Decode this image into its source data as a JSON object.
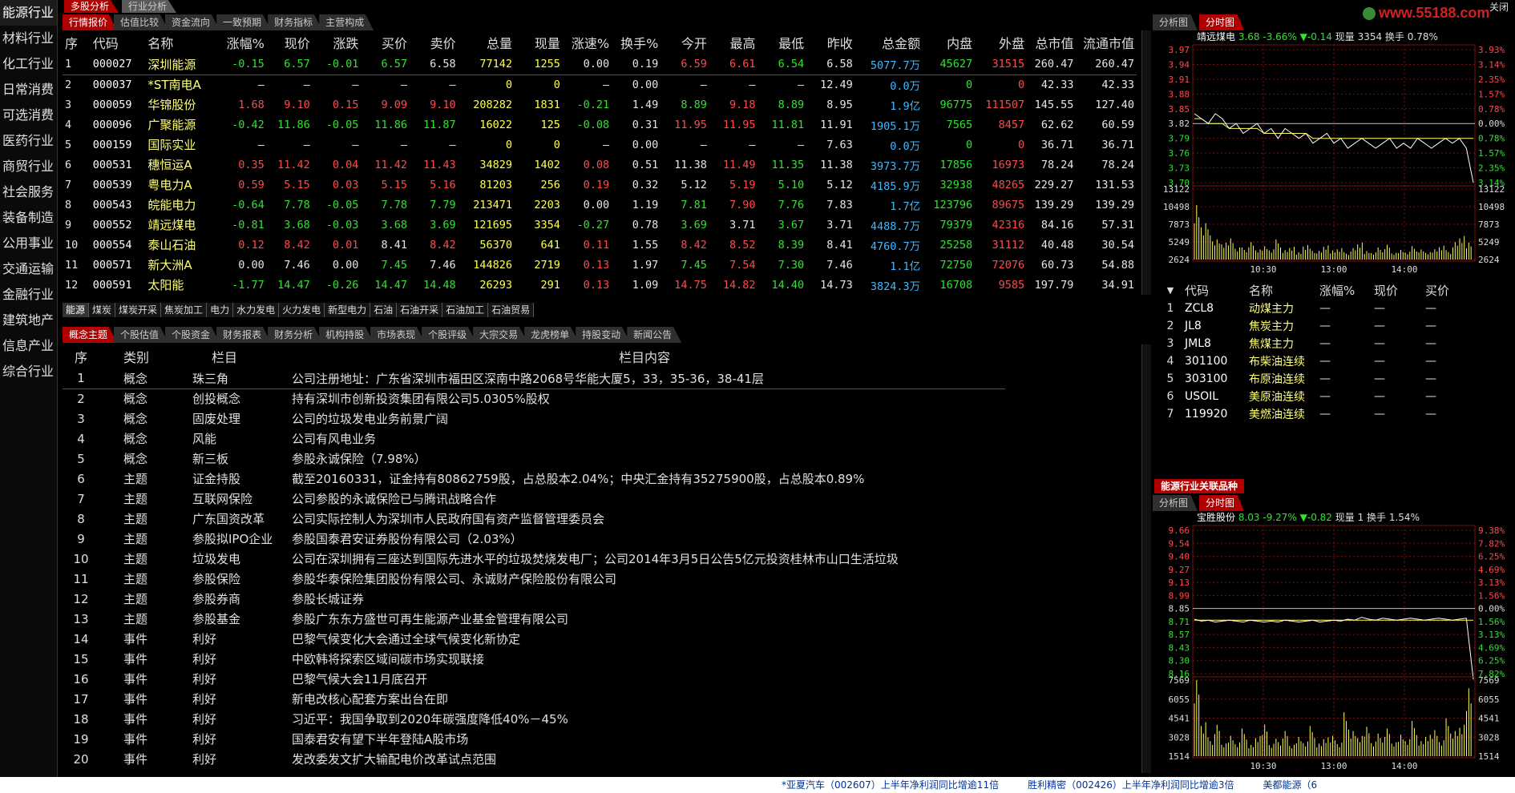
{
  "sidebar": {
    "items": [
      "能源行业",
      "材料行业",
      "化工行业",
      "日常消费",
      "可选消费",
      "医药行业",
      "商贸行业",
      "社会服务",
      "装备制造",
      "公用事业",
      "交通运输",
      "金融行业",
      "建筑地产",
      "信息产业",
      "综合行业"
    ]
  },
  "top_tabs": [
    "多股分析",
    "行业分析"
  ],
  "close_label": "关闭",
  "logo_text": "www.55188.com",
  "quote_tabs": [
    "行情报价",
    "估值比较",
    "资金流向",
    "一致预期",
    "财务指标",
    "主营构成"
  ],
  "quote_table": {
    "headers": [
      "序",
      "代码",
      "名称",
      "涨幅%",
      "现价",
      "涨跌",
      "买价",
      "卖价",
      "总量",
      "现量",
      "涨速%",
      "换手%",
      "今开",
      "最高",
      "最低",
      "昨收",
      "总金额",
      "内盘",
      "外盘",
      "总市值",
      "流通市值"
    ],
    "rows": [
      [
        "1",
        "000027",
        "深圳能源",
        "-0.15",
        "6.57",
        "-0.01",
        "6.57",
        "6.58",
        "77142",
        "1255",
        "0.00",
        "0.19",
        "6.59",
        "6.61",
        "6.54",
        "6.58",
        "5077.7万",
        "45627",
        "31515",
        "260.47",
        "260.47"
      ],
      [
        "2",
        "000037",
        "*ST南电A",
        "—",
        "—",
        "—",
        "—",
        "—",
        "0",
        "0",
        "—",
        "0.00",
        "—",
        "—",
        "—",
        "12.49",
        "0.0万",
        "0",
        "0",
        "42.33",
        "42.33"
      ],
      [
        "3",
        "000059",
        "华锦股份",
        "1.68",
        "9.10",
        "0.15",
        "9.09",
        "9.10",
        "208282",
        "1831",
        "-0.21",
        "1.49",
        "8.89",
        "9.18",
        "8.89",
        "8.95",
        "1.9亿",
        "96775",
        "111507",
        "145.55",
        "127.40"
      ],
      [
        "4",
        "000096",
        "广聚能源",
        "-0.42",
        "11.86",
        "-0.05",
        "11.86",
        "11.87",
        "16022",
        "125",
        "-0.08",
        "0.31",
        "11.95",
        "11.95",
        "11.81",
        "11.91",
        "1905.1万",
        "7565",
        "8457",
        "62.62",
        "60.59"
      ],
      [
        "5",
        "000159",
        "国际实业",
        "—",
        "—",
        "—",
        "—",
        "—",
        "0",
        "0",
        "—",
        "0.00",
        "—",
        "—",
        "—",
        "7.63",
        "0.0万",
        "0",
        "0",
        "36.71",
        "36.71"
      ],
      [
        "6",
        "000531",
        "穗恒运A",
        "0.35",
        "11.42",
        "0.04",
        "11.42",
        "11.43",
        "34829",
        "1402",
        "0.08",
        "0.51",
        "11.38",
        "11.49",
        "11.35",
        "11.38",
        "3973.7万",
        "17856",
        "16973",
        "78.24",
        "78.24"
      ],
      [
        "7",
        "000539",
        "粤电力A",
        "0.59",
        "5.15",
        "0.03",
        "5.15",
        "5.16",
        "81203",
        "256",
        "0.19",
        "0.32",
        "5.12",
        "5.19",
        "5.10",
        "5.12",
        "4185.9万",
        "32938",
        "48265",
        "229.27",
        "131.53"
      ],
      [
        "8",
        "000543",
        "皖能电力",
        "-0.64",
        "7.78",
        "-0.05",
        "7.78",
        "7.79",
        "213471",
        "2203",
        "0.00",
        "1.19",
        "7.81",
        "7.90",
        "7.76",
        "7.83",
        "1.7亿",
        "123796",
        "89675",
        "139.29",
        "139.29"
      ],
      [
        "9",
        "000552",
        "靖远煤电",
        "-0.81",
        "3.68",
        "-0.03",
        "3.68",
        "3.69",
        "121695",
        "3354",
        "-0.27",
        "0.78",
        "3.69",
        "3.71",
        "3.67",
        "3.71",
        "4488.7万",
        "79379",
        "42316",
        "84.16",
        "57.31"
      ],
      [
        "10",
        "000554",
        "泰山石油",
        "0.12",
        "8.42",
        "0.01",
        "8.41",
        "8.42",
        "56370",
        "641",
        "0.11",
        "1.55",
        "8.42",
        "8.52",
        "8.39",
        "8.41",
        "4760.7万",
        "25258",
        "31112",
        "40.48",
        "30.54"
      ],
      [
        "11",
        "000571",
        "新大洲A",
        "0.00",
        "7.46",
        "0.00",
        "7.45",
        "7.46",
        "144826",
        "2719",
        "0.13",
        "1.97",
        "7.45",
        "7.54",
        "7.30",
        "7.46",
        "1.1亿",
        "72750",
        "72076",
        "60.73",
        "54.88"
      ],
      [
        "12",
        "000591",
        "太阳能",
        "-1.77",
        "14.47",
        "-0.26",
        "14.47",
        "14.48",
        "26293",
        "291",
        "0.13",
        "1.09",
        "14.75",
        "14.82",
        "14.40",
        "14.73",
        "3824.3万",
        "16708",
        "9585",
        "197.79",
        "34.91"
      ]
    ]
  },
  "industry_strip": [
    "能源",
    "煤炭",
    "煤炭开采",
    "焦炭加工",
    "电力",
    "水力发电",
    "火力发电",
    "新型电力",
    "石油",
    "石油开采",
    "石油加工",
    "石油贸易"
  ],
  "info_tabs": [
    "概念主题",
    "个股估值",
    "个股资金",
    "财务报表",
    "财务分析",
    "机构持股",
    "市场表现",
    "个股评级",
    "大宗交易",
    "龙虎榜单",
    "持股变动",
    "新闻公告"
  ],
  "concept_table": {
    "headers": [
      "序",
      "类别",
      "栏目",
      "栏目内容"
    ],
    "rows": [
      [
        "1",
        "概念",
        "珠三角",
        "公司注册地址：广东省深圳市福田区深南中路2068号华能大厦5，33，35-36，38-41层"
      ],
      [
        "2",
        "概念",
        "创投概念",
        "持有深圳市创新投资集团有限公司5.0305%股权"
      ],
      [
        "3",
        "概念",
        "固废处理",
        "公司的垃圾发电业务前景广阔"
      ],
      [
        "4",
        "概念",
        "风能",
        "公司有风电业务"
      ],
      [
        "5",
        "概念",
        "新三板",
        "参股永诚保险（7.98%）"
      ],
      [
        "6",
        "主题",
        "证金持股",
        "截至20160331，证金持有80862759股，占总股本2.04%；中央汇金持有35275900股，占总股本0.89%"
      ],
      [
        "7",
        "主题",
        "互联网保险",
        "公司参股的永诚保险已与腾讯战略合作"
      ],
      [
        "8",
        "主题",
        "广东国资改革",
        "公司实际控制人为深圳市人民政府国有资产监督管理委员会"
      ],
      [
        "9",
        "主题",
        "参股拟IPO企业",
        "参股国泰君安证券股份有限公司（2.03%）"
      ],
      [
        "10",
        "主题",
        "垃圾发电",
        "公司在深圳拥有三座达到国际先进水平的垃圾焚烧发电厂；公司2014年3月5日公告5亿元投资桂林市山口生活垃圾"
      ],
      [
        "11",
        "主题",
        "参股保险",
        "参股华泰保险集团股份有限公司、永诚财产保险股份有限公司"
      ],
      [
        "12",
        "主题",
        "参股券商",
        "参股长城证券"
      ],
      [
        "13",
        "主题",
        "参股基金",
        "参股广东东方盛世可再生能源产业基金管理有限公司"
      ],
      [
        "14",
        "事件",
        "利好",
        "巴黎气候变化大会通过全球气候变化新协定"
      ],
      [
        "15",
        "事件",
        "利好",
        "中欧韩将探索区域间碳市场实现联接"
      ],
      [
        "16",
        "事件",
        "利好",
        "巴黎气候大会11月底召开"
      ],
      [
        "17",
        "事件",
        "利好",
        "新电改核心配套方案出台在即"
      ],
      [
        "18",
        "事件",
        "利好",
        "习近平：我国争取到2020年碳强度降低40%－45%"
      ],
      [
        "19",
        "事件",
        "利好",
        "国泰君安有望下半年登陆A股市场"
      ],
      [
        "20",
        "事件",
        "利好",
        "发改委发文扩大输配电价改革试点范围"
      ]
    ]
  },
  "chart1": {
    "tabs": [
      "分析图",
      "分时图"
    ],
    "header": {
      "name": "靖远煤电",
      "price": "3.68",
      "pct": "-3.66%",
      "chg": "▼-0.14",
      "vol_label": "现量",
      "vol": "3354",
      "turn_label": "换手",
      "turn": "0.78%"
    },
    "price_left": [
      "3.97",
      "3.94",
      "3.91",
      "3.88",
      "3.85",
      "3.82",
      "3.79",
      "3.76",
      "3.73",
      "3.70"
    ],
    "price_right": [
      "3.93%",
      "3.14%",
      "2.35%",
      "1.57%",
      "0.78%",
      "0.00%",
      "0.78%",
      "1.57%",
      "2.35%",
      "3.14%"
    ],
    "vol_left": [
      "13122",
      "10498",
      "7873",
      "5249",
      "2624"
    ],
    "vol_right": [
      "13122",
      "10498",
      "7873",
      "5249",
      "2624"
    ],
    "times": [
      "10:30",
      "13:00",
      "14:00"
    ],
    "price_series": [
      3.84,
      3.83,
      3.82,
      3.84,
      3.83,
      3.81,
      3.82,
      3.8,
      3.81,
      3.82,
      3.8,
      3.81,
      3.79,
      3.81,
      3.8,
      3.79,
      3.8,
      3.78,
      3.79,
      3.8,
      3.78,
      3.79,
      3.77,
      3.78,
      3.79,
      3.78,
      3.77,
      3.78,
      3.79,
      3.77,
      3.78,
      3.77,
      3.79,
      3.78,
      3.77,
      3.78,
      3.79,
      3.78,
      3.79,
      3.77,
      3.7
    ],
    "avg_series": [
      3.83,
      3.83,
      3.82,
      3.82,
      3.82,
      3.81,
      3.81,
      3.81,
      3.81,
      3.81,
      3.8,
      3.8,
      3.8,
      3.8,
      3.8,
      3.8,
      3.8,
      3.79,
      3.79,
      3.79,
      3.79,
      3.79,
      3.79,
      3.79,
      3.79,
      3.79,
      3.79,
      3.79,
      3.79,
      3.79,
      3.79,
      3.79,
      3.79,
      3.79,
      3.79,
      3.79,
      3.79,
      3.79,
      3.79,
      3.79,
      3.79
    ],
    "volumes": [
      9000,
      6000,
      4500,
      3000,
      2500,
      3500,
      2000,
      1800,
      2600,
      1500,
      2200,
      1700,
      3000,
      1400,
      1900,
      1200,
      2400,
      1600,
      1300,
      2100,
      1500,
      1900,
      1100,
      1700,
      2500,
      1400,
      1200,
      1800,
      2200,
      1000,
      1600,
      1300,
      2000,
      1500,
      1100,
      1700,
      2300,
      1400,
      2600,
      3500,
      2800
    ]
  },
  "futures_table": {
    "headers": [
      "代码",
      "名称",
      "涨幅%",
      "现价",
      "买价"
    ],
    "rows": [
      [
        "1",
        "ZCL8",
        "动煤主力",
        "—",
        "—",
        "—"
      ],
      [
        "2",
        "JL8",
        "焦炭主力",
        "—",
        "—",
        "—"
      ],
      [
        "3",
        "JML8",
        "焦煤主力",
        "—",
        "—",
        "—"
      ],
      [
        "4",
        "301100",
        "布柴油连续",
        "—",
        "—",
        "—"
      ],
      [
        "5",
        "303100",
        "布原油连续",
        "—",
        "—",
        "—"
      ],
      [
        "6",
        "USOIL",
        "美原油连续",
        "—",
        "—",
        "—"
      ],
      [
        "7",
        "119920",
        "美燃油连续",
        "—",
        "—",
        "—"
      ]
    ]
  },
  "related_title": "能源行业关联品种",
  "chart2": {
    "tabs": [
      "分析图",
      "分时图"
    ],
    "header": {
      "name": "宝胜股份",
      "price": "8.03",
      "pct": "-9.27%",
      "chg": "▼-0.82",
      "vol_label": "现量",
      "vol": "1",
      "turn_label": "换手",
      "turn": "1.54%"
    },
    "price_left": [
      "9.66",
      "9.54",
      "9.40",
      "9.27",
      "9.13",
      "8.99",
      "8.85",
      "8.71",
      "8.57",
      "8.43",
      "8.30",
      "8.16"
    ],
    "price_right": [
      "9.38%",
      "7.82%",
      "6.25%",
      "4.69%",
      "3.13%",
      "1.56%",
      "0.00%",
      "1.56%",
      "3.13%",
      "4.69%",
      "6.25%",
      "7.82%"
    ],
    "vol_left": [
      "7569",
      "6055",
      "4541",
      "3028",
      "1514"
    ],
    "vol_right": [
      "7569",
      "6055",
      "4541",
      "3028",
      "1514"
    ],
    "times": [
      "10:30",
      "13:00",
      "14:00"
    ],
    "price_series": [
      8.73,
      8.71,
      8.72,
      8.7,
      8.71,
      8.72,
      8.71,
      8.7,
      8.72,
      8.71,
      8.7,
      8.71,
      8.7,
      8.72,
      8.71,
      8.7,
      8.71,
      8.72,
      8.7,
      8.71,
      8.72,
      8.71,
      8.73,
      8.72,
      8.75,
      8.73,
      8.72,
      8.74,
      8.73,
      8.72,
      8.73,
      8.74,
      8.73,
      8.72,
      8.73,
      8.74,
      8.73,
      8.72,
      8.73,
      8.74,
      8.1
    ],
    "avg_series": [
      8.72,
      8.72,
      8.72,
      8.72,
      8.72,
      8.72,
      8.72,
      8.72,
      8.72,
      8.72,
      8.72,
      8.72,
      8.72,
      8.72,
      8.72,
      8.72,
      8.72,
      8.72,
      8.72,
      8.72,
      8.72,
      8.72,
      8.72,
      8.72,
      8.72,
      8.72,
      8.72,
      8.72,
      8.72,
      8.72,
      8.72,
      8.72,
      8.72,
      8.72,
      8.72,
      8.72,
      8.72,
      8.72,
      8.72,
      8.72,
      8.72
    ],
    "volumes": [
      7000,
      3000,
      1500,
      2500,
      1000,
      1800,
      1200,
      2200,
      900,
      1600,
      2800,
      1100,
      1400,
      2000,
      900,
      1700,
      1300,
      2400,
      1000,
      1500,
      1800,
      1200,
      3500,
      2000,
      1600,
      2600,
      1300,
      1800,
      2200,
      1100,
      1900,
      1500,
      2800,
      1200,
      1700,
      2300,
      1400,
      3000,
      2000,
      2500,
      6000
    ]
  },
  "ticker": "*亚夏汽车（002607）上半年净利润同比增逾11倍　　　胜利精密（002426）上半年净利润同比增逾3倍　　　美都能源（6"
}
